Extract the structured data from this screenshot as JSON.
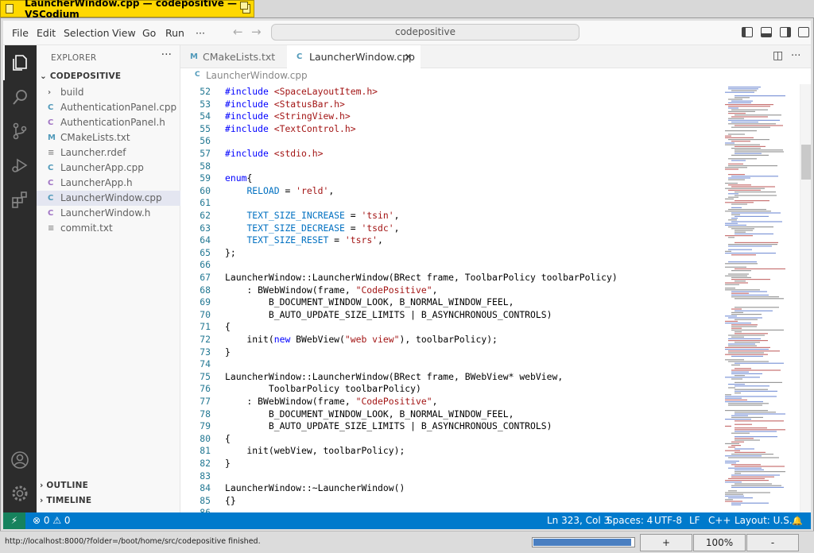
{
  "window": {
    "title": "LauncherWindow.cpp — codepositive — VSCodium"
  },
  "menu": {
    "items": [
      "File",
      "Edit",
      "Selection",
      "View",
      "Go",
      "Run",
      "···"
    ]
  },
  "command_center": {
    "text": "codepositive"
  },
  "explorer": {
    "header": "EXPLORER",
    "more": "···",
    "project": "CODEPOSITIVE",
    "items": [
      {
        "icon": "›",
        "name": "build",
        "color": "#616161"
      },
      {
        "icon": "C",
        "name": "AuthenticationPanel.cpp",
        "color": "#519aba"
      },
      {
        "icon": "C",
        "name": "AuthenticationPanel.h",
        "color": "#a074c4"
      },
      {
        "icon": "M",
        "name": "CMakeLists.txt",
        "color": "#519aba"
      },
      {
        "icon": "≡",
        "name": "Launcher.rdef",
        "color": "#8a8a8a"
      },
      {
        "icon": "C",
        "name": "LauncherApp.cpp",
        "color": "#519aba"
      },
      {
        "icon": "C",
        "name": "LauncherApp.h",
        "color": "#a074c4"
      },
      {
        "icon": "C",
        "name": "LauncherWindow.cpp",
        "color": "#519aba"
      },
      {
        "icon": "C",
        "name": "LauncherWindow.h",
        "color": "#a074c4"
      },
      {
        "icon": "≡",
        "name": "commit.txt",
        "color": "#8a8a8a"
      }
    ],
    "outline": "OUTLINE",
    "timeline": "TIMELINE"
  },
  "tabs": [
    {
      "icon": "M",
      "label": "CMakeLists.txt"
    },
    {
      "icon": "C",
      "label": "LauncherWindow.cpp",
      "close": "✕"
    }
  ],
  "editor_actions": {
    "split": "◫",
    "more": "···"
  },
  "breadcrumb": "LauncherWindow.cpp",
  "code": [
    {
      "n": "52",
      "t": [
        [
          "pp",
          "#include "
        ],
        [
          "str",
          "<SpaceLayoutItem.h>"
        ]
      ]
    },
    {
      "n": "53",
      "t": [
        [
          "pp",
          "#include "
        ],
        [
          "str",
          "<StatusBar.h>"
        ]
      ]
    },
    {
      "n": "54",
      "t": [
        [
          "pp",
          "#include "
        ],
        [
          "str",
          "<StringView.h>"
        ]
      ]
    },
    {
      "n": "55",
      "t": [
        [
          "pp",
          "#include "
        ],
        [
          "str",
          "<TextControl.h>"
        ]
      ]
    },
    {
      "n": "56",
      "t": []
    },
    {
      "n": "57",
      "t": [
        [
          "pp",
          "#include "
        ],
        [
          "str",
          "<stdio.h>"
        ]
      ]
    },
    {
      "n": "58",
      "t": []
    },
    {
      "n": "59",
      "t": [
        [
          "kw",
          "enum"
        ],
        [
          "",
          "{"
        ]
      ]
    },
    {
      "n": "60",
      "t": [
        [
          "",
          "    "
        ],
        [
          "con",
          "RELOAD"
        ],
        [
          "",
          " = "
        ],
        [
          "str",
          "'reld'"
        ],
        [
          "",
          ","
        ]
      ]
    },
    {
      "n": "61",
      "t": []
    },
    {
      "n": "62",
      "t": [
        [
          "",
          "    "
        ],
        [
          "con",
          "TEXT_SIZE_INCREASE"
        ],
        [
          "",
          " = "
        ],
        [
          "str",
          "'tsin'"
        ],
        [
          "",
          ","
        ]
      ]
    },
    {
      "n": "63",
      "t": [
        [
          "",
          "    "
        ],
        [
          "con",
          "TEXT_SIZE_DECREASE"
        ],
        [
          "",
          " = "
        ],
        [
          "str",
          "'tsdc'"
        ],
        [
          "",
          ","
        ]
      ]
    },
    {
      "n": "64",
      "t": [
        [
          "",
          "    "
        ],
        [
          "con",
          "TEXT_SIZE_RESET"
        ],
        [
          "",
          " = "
        ],
        [
          "str",
          "'tsrs'"
        ],
        [
          "",
          ","
        ]
      ]
    },
    {
      "n": "65",
      "t": [
        [
          "",
          "};"
        ]
      ]
    },
    {
      "n": "66",
      "t": []
    },
    {
      "n": "67",
      "t": [
        [
          "",
          "LauncherWindow::LauncherWindow(BRect frame, ToolbarPolicy toolbarPolicy)"
        ]
      ]
    },
    {
      "n": "68",
      "t": [
        [
          "",
          "    : BWebWindow(frame, "
        ],
        [
          "str",
          "\"CodePositive\""
        ],
        [
          "",
          ","
        ]
      ]
    },
    {
      "n": "69",
      "t": [
        [
          "",
          "        B_DOCUMENT_WINDOW_LOOK, B_NORMAL_WINDOW_FEEL,"
        ]
      ]
    },
    {
      "n": "70",
      "t": [
        [
          "",
          "        B_AUTO_UPDATE_SIZE_LIMITS | B_ASYNCHRONOUS_CONTROLS)"
        ]
      ]
    },
    {
      "n": "71",
      "t": [
        [
          "",
          "{"
        ]
      ]
    },
    {
      "n": "72",
      "t": [
        [
          "",
          "    init("
        ],
        [
          "kw",
          "new"
        ],
        [
          "",
          " BWebView("
        ],
        [
          "str",
          "\"web view\""
        ],
        [
          "",
          "), toolbarPolicy);"
        ]
      ]
    },
    {
      "n": "73",
      "t": [
        [
          "",
          "}"
        ]
      ]
    },
    {
      "n": "74",
      "t": []
    },
    {
      "n": "75",
      "t": [
        [
          "",
          "LauncherWindow::LauncherWindow(BRect frame, BWebView* webView,"
        ]
      ]
    },
    {
      "n": "76",
      "t": [
        [
          "",
          "        ToolbarPolicy toolbarPolicy)"
        ]
      ]
    },
    {
      "n": "77",
      "t": [
        [
          "",
          "    : BWebWindow(frame, "
        ],
        [
          "str",
          "\"CodePositive\""
        ],
        [
          "",
          ","
        ]
      ]
    },
    {
      "n": "78",
      "t": [
        [
          "",
          "        B_DOCUMENT_WINDOW_LOOK, B_NORMAL_WINDOW_FEEL,"
        ]
      ]
    },
    {
      "n": "79",
      "t": [
        [
          "",
          "        B_AUTO_UPDATE_SIZE_LIMITS | B_ASYNCHRONOUS_CONTROLS)"
        ]
      ]
    },
    {
      "n": "80",
      "t": [
        [
          "",
          "{"
        ]
      ]
    },
    {
      "n": "81",
      "t": [
        [
          "",
          "    init(webView, toolbarPolicy);"
        ]
      ]
    },
    {
      "n": "82",
      "t": [
        [
          "",
          "}"
        ]
      ]
    },
    {
      "n": "83",
      "t": []
    },
    {
      "n": "84",
      "t": [
        [
          "",
          "LauncherWindow::~LauncherWindow()"
        ]
      ]
    },
    {
      "n": "85",
      "t": [
        [
          "",
          "{}"
        ]
      ]
    },
    {
      "n": "86",
      "t": []
    }
  ],
  "status": {
    "remote": "⚡",
    "problems": "⊗ 0 ⚠ 0",
    "position": "Ln 323, Col 3",
    "spaces": "Spaces: 4",
    "encoding": "UTF-8",
    "eol": "LF",
    "language": "C++",
    "layout": "Layout: U.S.",
    "bell": "🔔"
  },
  "browser_status": {
    "url": "http://localhost:8000/?folder=/boot/home/src/codepositive finished.",
    "progress_fraction": 0.98,
    "zoom_in": "+",
    "zoom": "100%",
    "zoom_out": "-"
  },
  "colors": {
    "accent": "#007acc",
    "remote": "#16825d",
    "title_tab": "#ffd800"
  }
}
